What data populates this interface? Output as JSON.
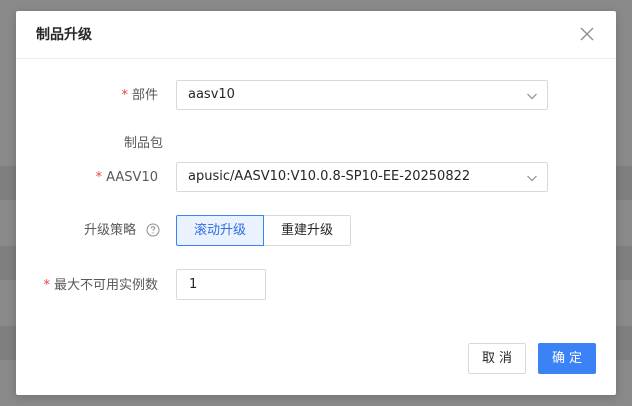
{
  "dialog": {
    "title": "制品升级",
    "close_icon": "close-icon"
  },
  "form": {
    "component": {
      "required_mark": "*",
      "label": "部件",
      "value": "aasv10"
    },
    "artifact_section_label": "制品包",
    "aasv10": {
      "required_mark": "*",
      "label": "AASV10",
      "value": "apusic/AASV10:V10.0.8-SP10-EE-20250822"
    },
    "strategy": {
      "label": "升级策略",
      "help_icon": "question-circle-icon",
      "options": [
        "滚动升级",
        "重建升级"
      ],
      "selected": "滚动升级"
    },
    "max_unavailable": {
      "required_mark": "*",
      "label": "最大不可用实例数",
      "value": "1"
    }
  },
  "footer": {
    "cancel_label": "取消",
    "ok_label": "确定"
  },
  "colors": {
    "primary": "#3b82f6",
    "required": "#e54545",
    "overlay": "#8a8a8a"
  }
}
